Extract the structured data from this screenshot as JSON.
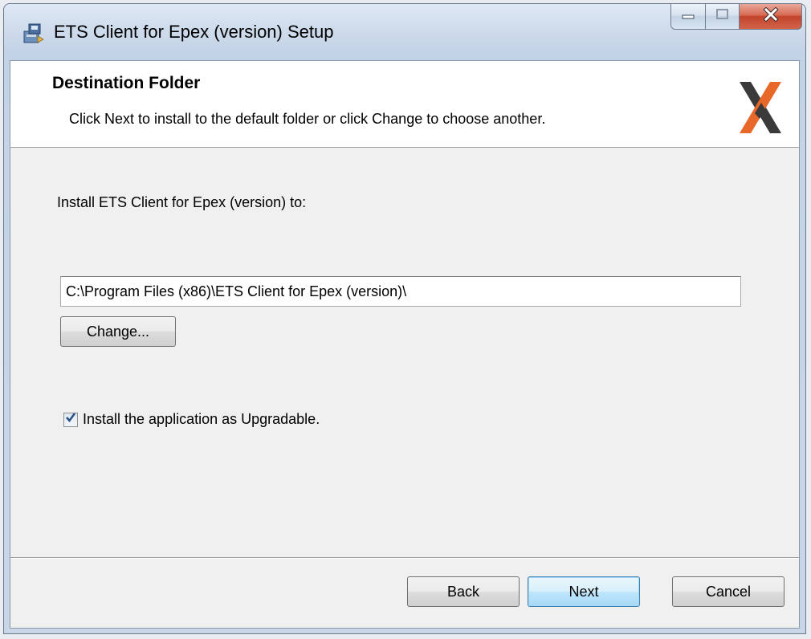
{
  "window": {
    "title": "ETS Client for Epex (version) Setup",
    "controls": [
      "minimize",
      "maximize",
      "close"
    ]
  },
  "header": {
    "title": "Destination Folder",
    "description": "Click Next to install to the default folder or click Change to choose another."
  },
  "main": {
    "install_label": "Install ETS Client for Epex (version) to:",
    "install_path": "C:\\Program Files (x86)\\ETS Client for Epex (version)\\",
    "change_button": "Change...",
    "upgradable_checkbox": {
      "label": "Install the application as Upgradable.",
      "checked": true
    }
  },
  "footer": {
    "back_button": "Back",
    "next_button": "Next",
    "cancel_button": "Cancel"
  },
  "colors": {
    "logo_orange": "#e8682a",
    "logo_dark": "#3a3a3a",
    "default_button_border": "#3c7fb1"
  }
}
